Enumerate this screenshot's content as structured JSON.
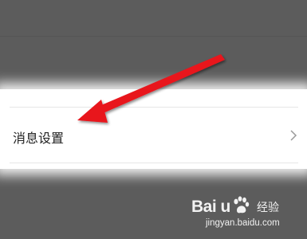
{
  "settings_list": {
    "blurred_top_left": "",
    "blurred_top_right": "",
    "blurred_second": "",
    "blurred_bottom": "",
    "highlighted_item": {
      "label": "消息设置"
    }
  },
  "watermark": {
    "logo_text": "Bai  u",
    "brand_cn": "经验",
    "url": "jingyan.baidu.com"
  },
  "colors": {
    "dim_overlay": "#5c5c5c",
    "highlight": "#ffffff",
    "arrow": "#e8141e"
  },
  "icons": {
    "chevron": "chevron-right-icon",
    "paw": "baidu-paw-icon",
    "arrow": "red-pointer-arrow"
  }
}
